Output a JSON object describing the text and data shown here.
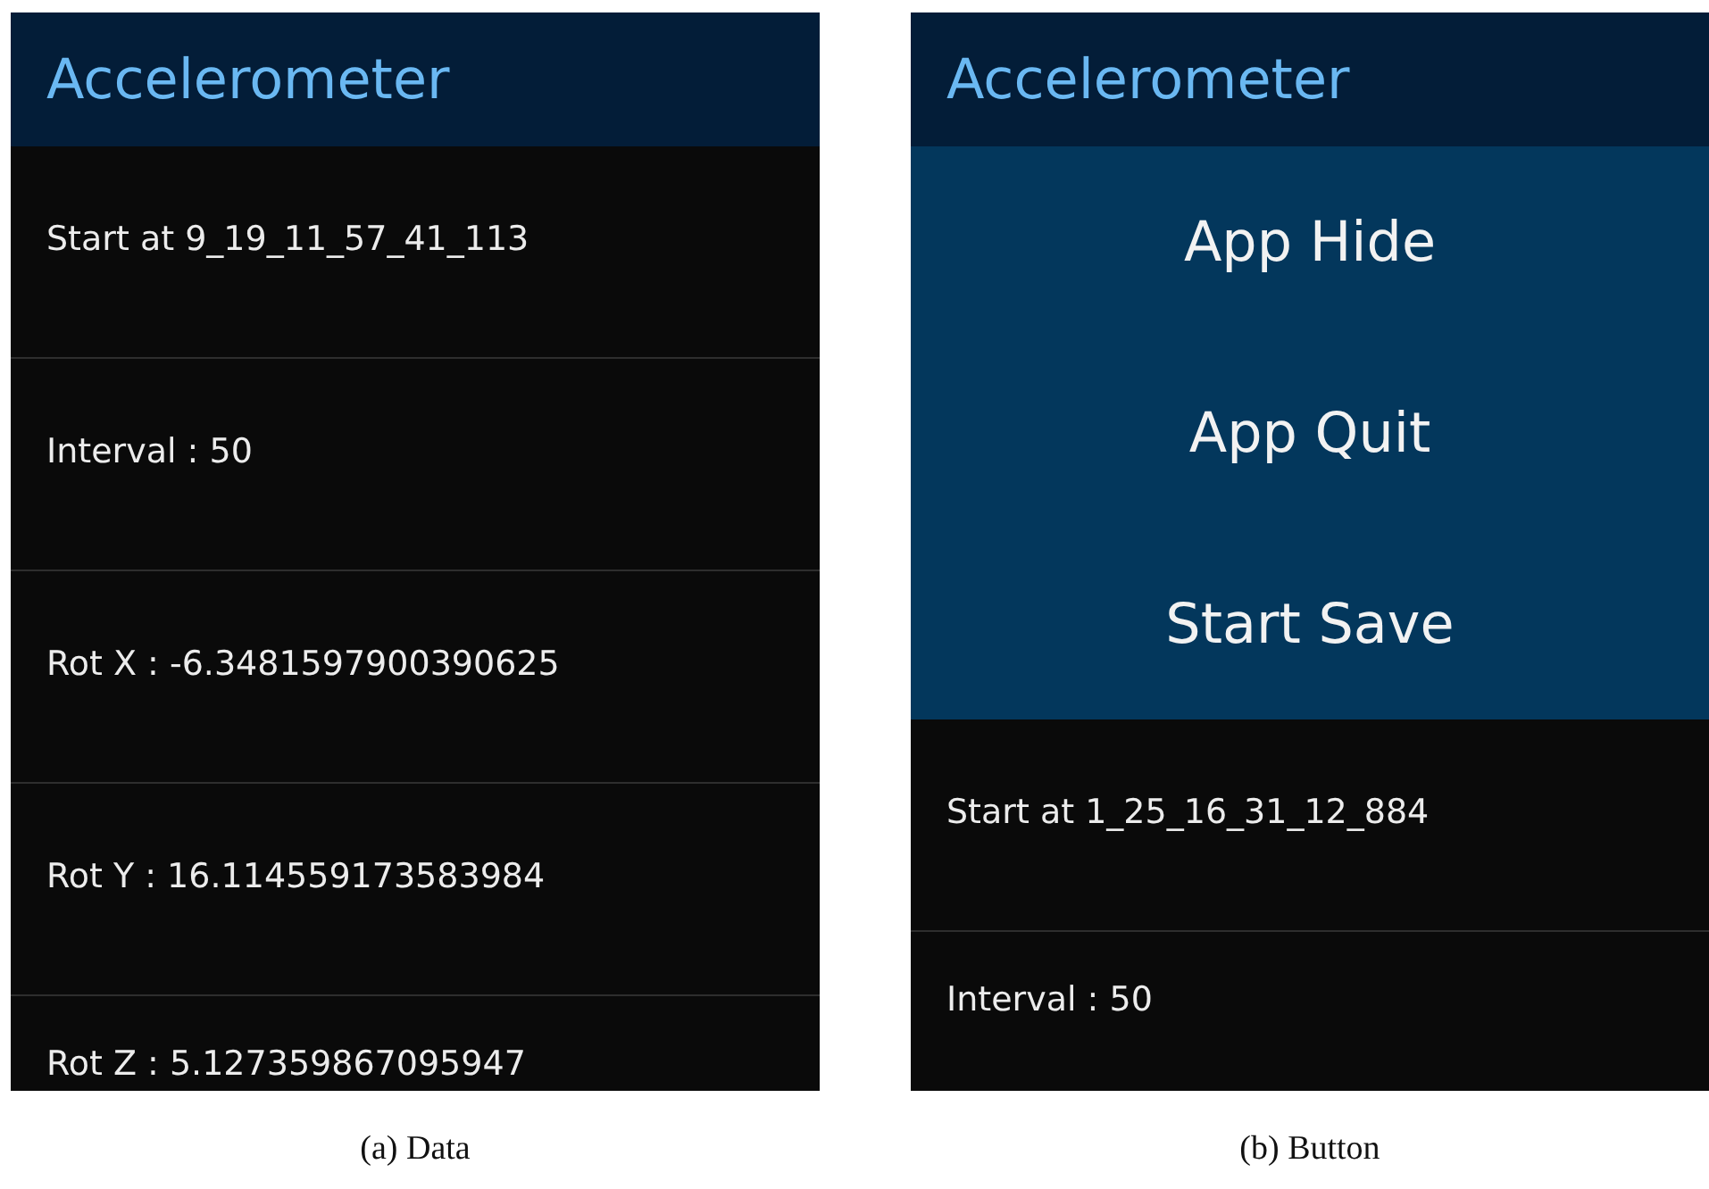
{
  "figures": [
    {
      "caption": "(a) Data",
      "screen": {
        "title": "Accelerometer",
        "rows": [
          "Start at 9_19_11_57_41_113",
          "Interval : 50",
          "Rot X : -6.3481597900390625",
          "Rot Y : 16.114559173583984",
          "Rot Z : 5.127359867095947"
        ]
      }
    },
    {
      "caption": "(b) Button",
      "screen": {
        "title": "Accelerometer",
        "menu": [
          "App Hide",
          "App Quit",
          "Start Save"
        ],
        "rows": [
          "Start at 1_25_16_31_12_884",
          "Interval : 50"
        ]
      }
    }
  ]
}
